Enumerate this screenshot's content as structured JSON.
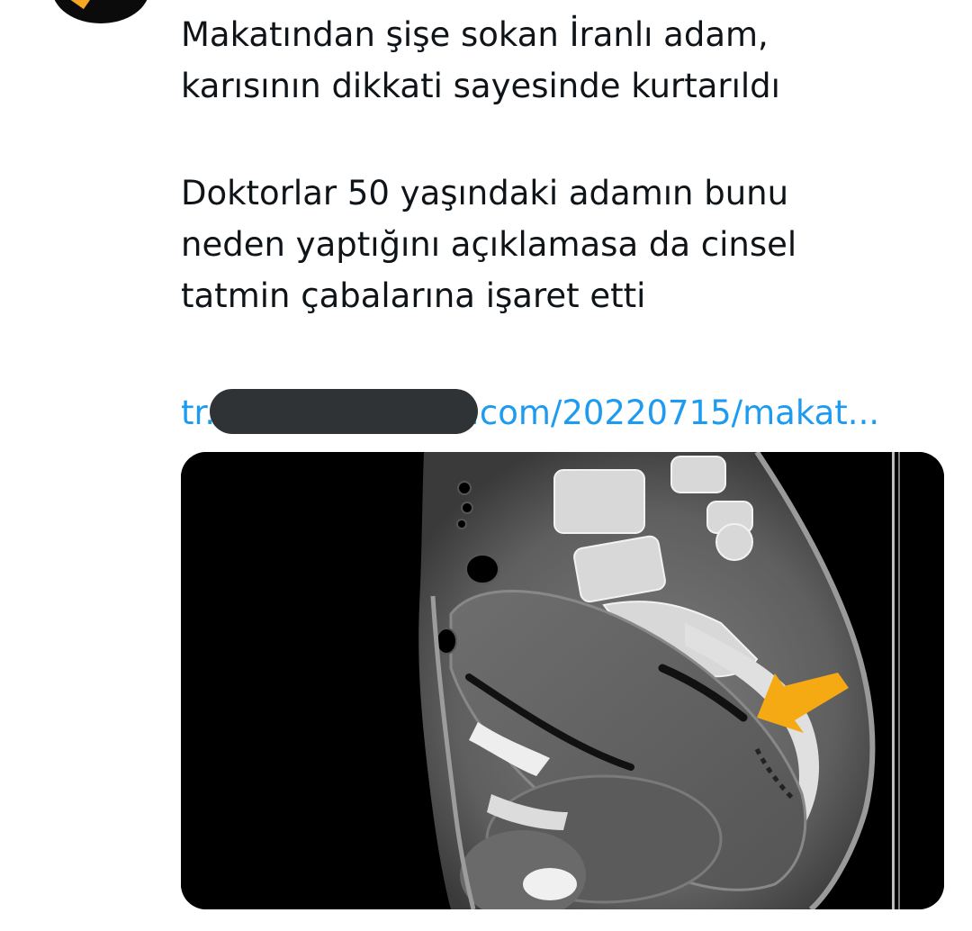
{
  "tweet": {
    "lines_block1": [
      "Makatından şişe sokan İranlı adam,",
      "karısının dikkati sayesinde kurtarıldı"
    ],
    "lines_block2": [
      "Doktorlar 50 yaşındaki adamın bunu",
      "neden yaptığını açıklamasa da cinsel",
      "tatmin çabalarına işaret etti"
    ],
    "link": {
      "prefix": "tr.",
      "suffix": ".com/20220715/makat..."
    }
  },
  "media": {
    "description_icon": "ct-scan-image",
    "annotation_icon": "arrow-icon",
    "annotation_color": "#f5a912"
  },
  "avatar": {
    "icon": "avatar"
  }
}
